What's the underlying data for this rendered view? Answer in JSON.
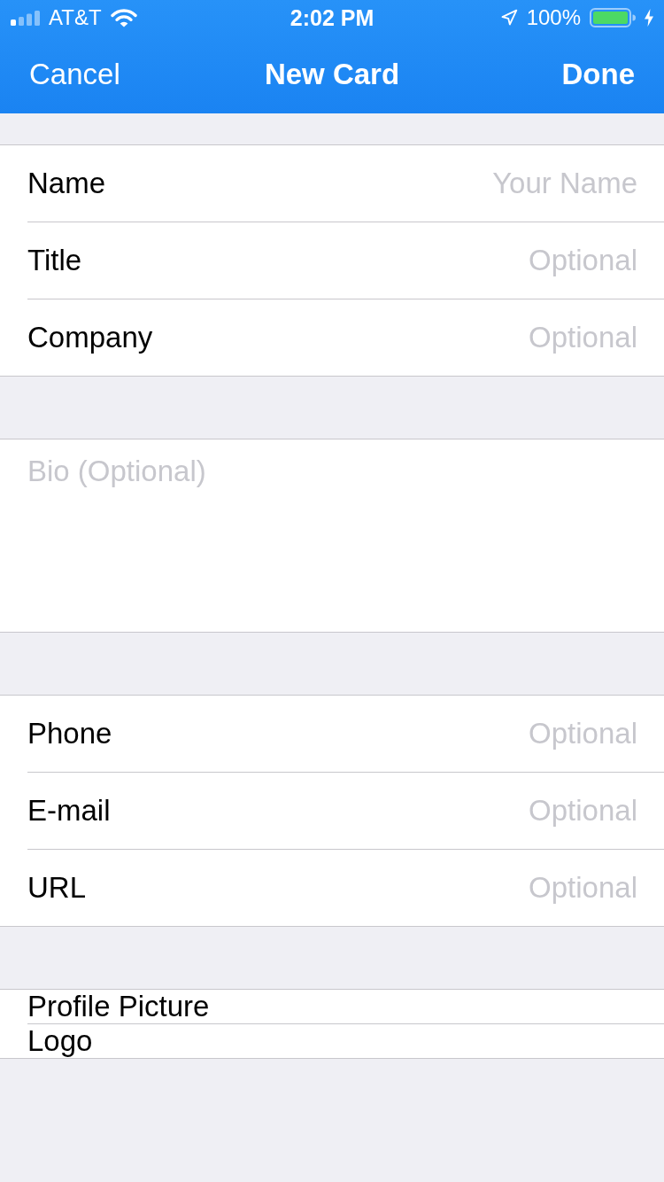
{
  "status_bar": {
    "carrier": "AT&T",
    "time": "2:02 PM",
    "battery": "100%"
  },
  "nav_bar": {
    "left_button": "Cancel",
    "title": "New Card",
    "right_button": "Done"
  },
  "sections": [
    {
      "rows": [
        {
          "kind": "field",
          "label": "Name",
          "placeholder": "Your Name"
        },
        {
          "kind": "field",
          "label": "Title",
          "placeholder": "Optional"
        },
        {
          "kind": "field",
          "label": "Company",
          "placeholder": "Optional"
        }
      ]
    },
    {
      "rows": [
        {
          "kind": "textarea",
          "placeholder": "Bio (Optional)"
        }
      ]
    },
    {
      "rows": [
        {
          "kind": "field",
          "label": "Phone",
          "placeholder": "Optional"
        },
        {
          "kind": "field",
          "label": "E-mail",
          "placeholder": "Optional"
        },
        {
          "kind": "field",
          "label": "URL",
          "placeholder": "Optional"
        }
      ]
    },
    {
      "rows": [
        {
          "kind": "link",
          "label": "Profile Picture"
        },
        {
          "kind": "link",
          "label": "Logo"
        }
      ]
    }
  ]
}
